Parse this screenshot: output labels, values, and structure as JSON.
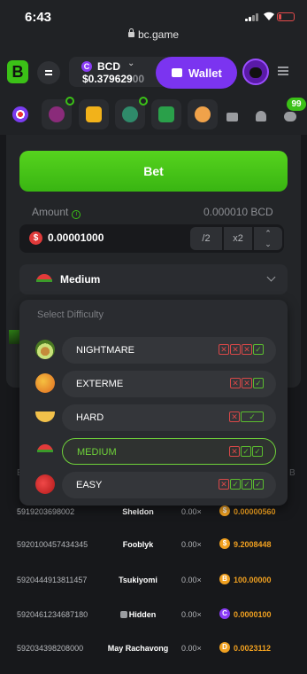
{
  "status": {
    "time": "6:43"
  },
  "browser": {
    "url": "bc.game"
  },
  "header": {
    "logo": "B",
    "currency": "BCD",
    "currency_icon": "C",
    "chevron": "⌄",
    "balance_main": "$0.379629",
    "balance_dim": "00",
    "wallet_label": "Wallet"
  },
  "nav": {
    "chat_badge": "99"
  },
  "bet": {
    "button_label": "Bet",
    "amount_label": "Amount",
    "info_glyph": "i",
    "amount_conv": "0.000010 BCD",
    "currency_symbol": "$",
    "amount_value": "0.00001000",
    "half_label": "/2",
    "double_label": "x2",
    "up_arrow": "⌃",
    "down_arrow": "⌄"
  },
  "difficulty": {
    "selected": "Medium",
    "panel_title": "Select Difficulty",
    "options": [
      {
        "label": "NIGHTMARE",
        "fruit": "avocado-icon",
        "marks": [
          "x",
          "x",
          "x",
          "v"
        ]
      },
      {
        "label": "EXTERME",
        "fruit": "mango-icon",
        "marks": [
          "x",
          "x",
          "v"
        ]
      },
      {
        "label": "HARD",
        "fruit": "banana-icon",
        "marks": [
          "x",
          "v"
        ]
      },
      {
        "label": "MEDIUM",
        "fruit": "watermelon-icon",
        "marks": [
          "x",
          "v",
          "v"
        ]
      },
      {
        "label": "EASY",
        "fruit": "apple-icon",
        "marks": [
          "x",
          "v",
          "v",
          "v"
        ]
      }
    ]
  },
  "colors": {
    "accent_green": "#3bc117",
    "wallet_purple": "#7b34f0",
    "payout_orange": "#f0a020",
    "loss_red": "#d84848"
  },
  "history": {
    "partial_header": "E",
    "partial_header_right": "B",
    "rows": [
      {
        "id": "5919203698002",
        "player": "Sheldon",
        "mult": "0.00×",
        "coin": "$",
        "coin_color": "#f0a020",
        "payout": "0.00000560"
      },
      {
        "id": "5920100457434345",
        "player": "Fooblyk",
        "mult": "0.00×",
        "coin": "$",
        "coin_color": "#f0a020",
        "payout": "9.2008448"
      },
      {
        "id": "5920444913811457",
        "player": "Tsukiyomi",
        "mult": "0.00×",
        "coin": "B",
        "coin_color": "#f0a020",
        "payout": "100.00000"
      },
      {
        "id": "5920461234687180",
        "player": "Hidden",
        "mult": "0.00×",
        "coin": "C",
        "coin_color": "#8a3cf5",
        "payout": "0.0000100"
      },
      {
        "id": "592034398208000",
        "player": "May Rachavong",
        "mult": "0.00×",
        "coin": "D",
        "coin_color": "#f0a020",
        "payout": "0.0023112"
      }
    ]
  }
}
